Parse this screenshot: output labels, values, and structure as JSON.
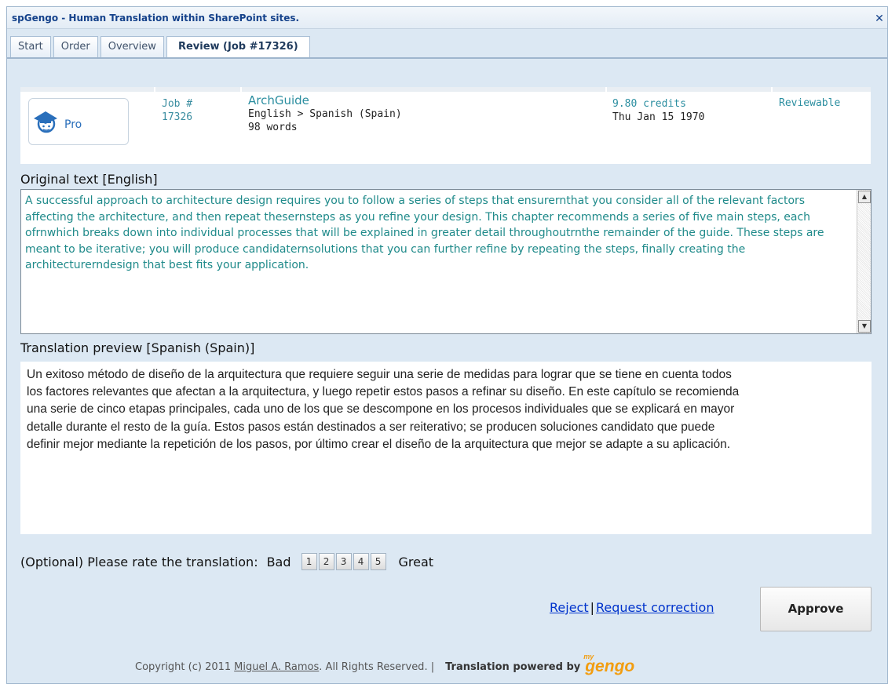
{
  "window": {
    "title": "spGengo - Human Translation within SharePoint sites.",
    "close_glyph": "✕"
  },
  "tabs": [
    {
      "label": "Start",
      "active": false
    },
    {
      "label": "Order",
      "active": false
    },
    {
      "label": "Overview",
      "active": false
    },
    {
      "label": "Review (Job #17326)",
      "active": true
    }
  ],
  "job": {
    "tier": "Pro",
    "id_label": "Job #",
    "id": "17326",
    "name": "ArchGuide",
    "languages": "English > Spanish (Spain)",
    "word_count": "98 words",
    "credits": "9.80 credits",
    "date": "Thu Jan 15 1970",
    "status": "Reviewable"
  },
  "original": {
    "label": "Original text [English]",
    "text": "A successful approach to architecture design requires you to follow a series of steps that ensurernthat you consider all of the relevant factors affecting the architecture, and then repeat thesernsteps as you refine your design. This chapter recommends a series of five main steps, each ofrnwhich breaks down into individual processes that will be explained in greater detail throughoutrnthe remainder of the guide. These steps are meant to be iterative; you will produce candidaternsolutions that you can further refine by repeating the steps, finally creating the architecturerndesign that best fits your application."
  },
  "translation": {
    "label": "Translation preview [Spanish (Spain)]",
    "text": "Un exitoso método de diseño de la arquitectura que requiere seguir una serie de medidas para lograr que se tiene en cuenta todos los factores relevantes que afectan a la arquitectura, y luego repetir estos pasos a refinar su diseño. En este capítulo se recomienda una serie de cinco etapas principales, cada uno de los que se descompone en los procesos individuales que se explicará en mayor detalle durante el resto de la guía. Estos pasos están destinados a ser reiterativo; se producen soluciones candidato que puede definir mejor mediante la repetición de los pasos, por último crear el diseño de la arquitectura que mejor se adapte a su aplicación."
  },
  "rating": {
    "label": "(Optional) Please rate the translation:",
    "low": "Bad",
    "high": "Great",
    "options": [
      "1",
      "2",
      "3",
      "4",
      "5"
    ]
  },
  "actions": {
    "reject": "Reject",
    "separator": "|",
    "request_correction": "Request correction",
    "approve": "Approve"
  },
  "footer": {
    "copyright_prefix": "Copyright (c) 2011",
    "author": "Miguel A. Ramos",
    "copyright_suffix": ". All Rights Reserved. |",
    "powered_by": "Translation powered by",
    "brand_my": "my",
    "brand": "gengo"
  },
  "colors": {
    "accent": "#2b8ea0",
    "link": "#0033cc",
    "brand": "#f29d10",
    "title": "#15428b"
  }
}
